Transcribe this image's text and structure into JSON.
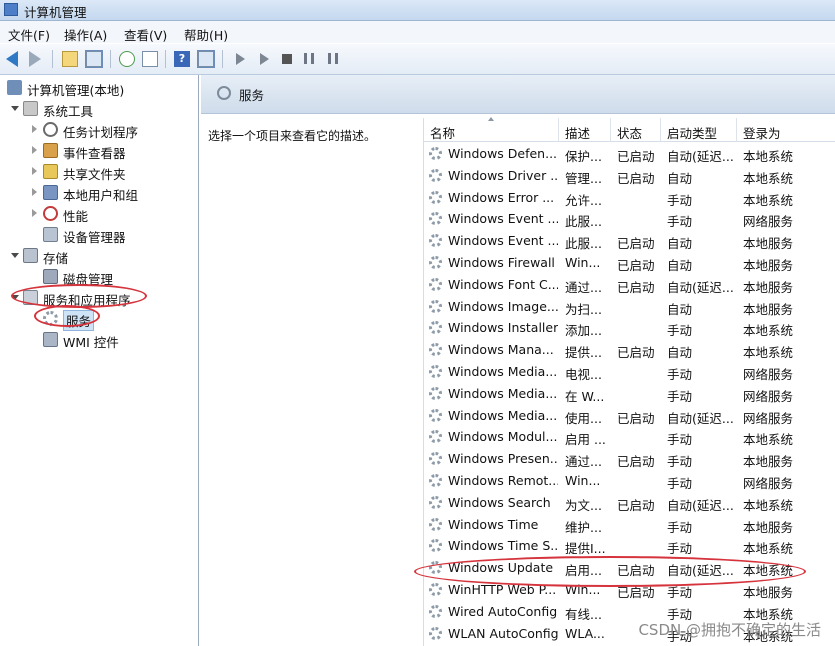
{
  "window": {
    "title": "计算机管理"
  },
  "menu": [
    "文件(F)",
    "操作(A)",
    "查看(V)",
    "帮助(H)"
  ],
  "toolbar_icons": [
    "back-arrow-icon",
    "forward-arrow-icon",
    "up-folder-icon",
    "show-hide-tree-icon",
    "refresh-icon",
    "export-list-icon",
    "help-icon",
    "console-view-icon",
    "start-service-icon",
    "start-service-alt-icon",
    "stop-service-icon",
    "pause-service-icon",
    "restart-service-icon"
  ],
  "tree": [
    {
      "label": "计算机管理(本地)",
      "icon": "computer-icon",
      "level": 0
    },
    {
      "label": "系统工具",
      "icon": "tools-icon",
      "level": 1,
      "expanded": true
    },
    {
      "label": "任务计划程序",
      "icon": "clock-icon",
      "level": 2
    },
    {
      "label": "事件查看器",
      "icon": "event-viewer-icon",
      "level": 2
    },
    {
      "label": "共享文件夹",
      "icon": "shared-folder-icon",
      "level": 2
    },
    {
      "label": "本地用户和组",
      "icon": "users-icon",
      "level": 2
    },
    {
      "label": "性能",
      "icon": "performance-icon",
      "level": 2
    },
    {
      "label": "设备管理器",
      "icon": "device-manager-icon",
      "level": 2
    },
    {
      "label": "存储",
      "icon": "storage-icon",
      "level": 1,
      "expanded": true
    },
    {
      "label": "磁盘管理",
      "icon": "disk-icon",
      "level": 2
    },
    {
      "label": "服务和应用程序",
      "icon": "services-apps-icon",
      "level": 1,
      "expanded": true
    },
    {
      "label": "服务",
      "icon": "services-icon",
      "level": 2,
      "selected": true
    },
    {
      "label": "WMI 控件",
      "icon": "wmi-icon",
      "level": 2
    }
  ],
  "panel": {
    "title": "服务",
    "description": "选择一个项目来查看它的描述。"
  },
  "columns": [
    "名称",
    "描述",
    "状态",
    "启动类型",
    "登录为"
  ],
  "services": [
    [
      "Windows Defen...",
      "保护...",
      "已启动",
      "自动(延迟...",
      "本地系统"
    ],
    [
      "Windows Driver ...",
      "管理...",
      "已启动",
      "自动",
      "本地系统"
    ],
    [
      "Windows Error ...",
      "允许...",
      "",
      "手动",
      "本地系统"
    ],
    [
      "Windows Event ...",
      "此服...",
      "",
      "手动",
      "网络服务"
    ],
    [
      "Windows Event ...",
      "此服...",
      "已启动",
      "自动",
      "本地服务"
    ],
    [
      "Windows Firewall",
      "Win...",
      "已启动",
      "自动",
      "本地服务"
    ],
    [
      "Windows Font C...",
      "通过...",
      "已启动",
      "自动(延迟...",
      "本地服务"
    ],
    [
      "Windows Image...",
      "为扫...",
      "",
      "自动",
      "本地服务"
    ],
    [
      "Windows Installer",
      "添加...",
      "",
      "手动",
      "本地系统"
    ],
    [
      "Windows Mana...",
      "提供...",
      "已启动",
      "自动",
      "本地系统"
    ],
    [
      "Windows Media...",
      "电视...",
      "",
      "手动",
      "网络服务"
    ],
    [
      "Windows Media...",
      "在 W...",
      "",
      "手动",
      "网络服务"
    ],
    [
      "Windows Media...",
      "使用...",
      "已启动",
      "自动(延迟...",
      "网络服务"
    ],
    [
      "Windows Modul...",
      "启用 ...",
      "",
      "手动",
      "本地系统"
    ],
    [
      "Windows Presen...",
      "通过...",
      "已启动",
      "手动",
      "本地服务"
    ],
    [
      "Windows Remot...",
      "Win...",
      "",
      "手动",
      "网络服务"
    ],
    [
      "Windows Search",
      "为文...",
      "已启动",
      "自动(延迟...",
      "本地系统"
    ],
    [
      "Windows Time",
      "维护...",
      "",
      "手动",
      "本地服务"
    ],
    [
      "Windows Time S...",
      "提供I...",
      "",
      "手动",
      "本地系统"
    ],
    [
      "Windows Update",
      "启用...",
      "已启动",
      "自动(延迟...",
      "本地系统"
    ],
    [
      "WinHTTP Web P...",
      "Win...",
      "已启动",
      "手动",
      "本地服务"
    ],
    [
      "Wired AutoConfig",
      "有线...",
      "",
      "手动",
      "本地系统"
    ],
    [
      "WLAN AutoConfig",
      "WLA...",
      "",
      "手动",
      "本地系统"
    ]
  ],
  "watermark": "CSDN @拥抱不确定的生活",
  "colors": {
    "highlight_oval": "#d6343d",
    "selection": "#cfe3f7"
  }
}
